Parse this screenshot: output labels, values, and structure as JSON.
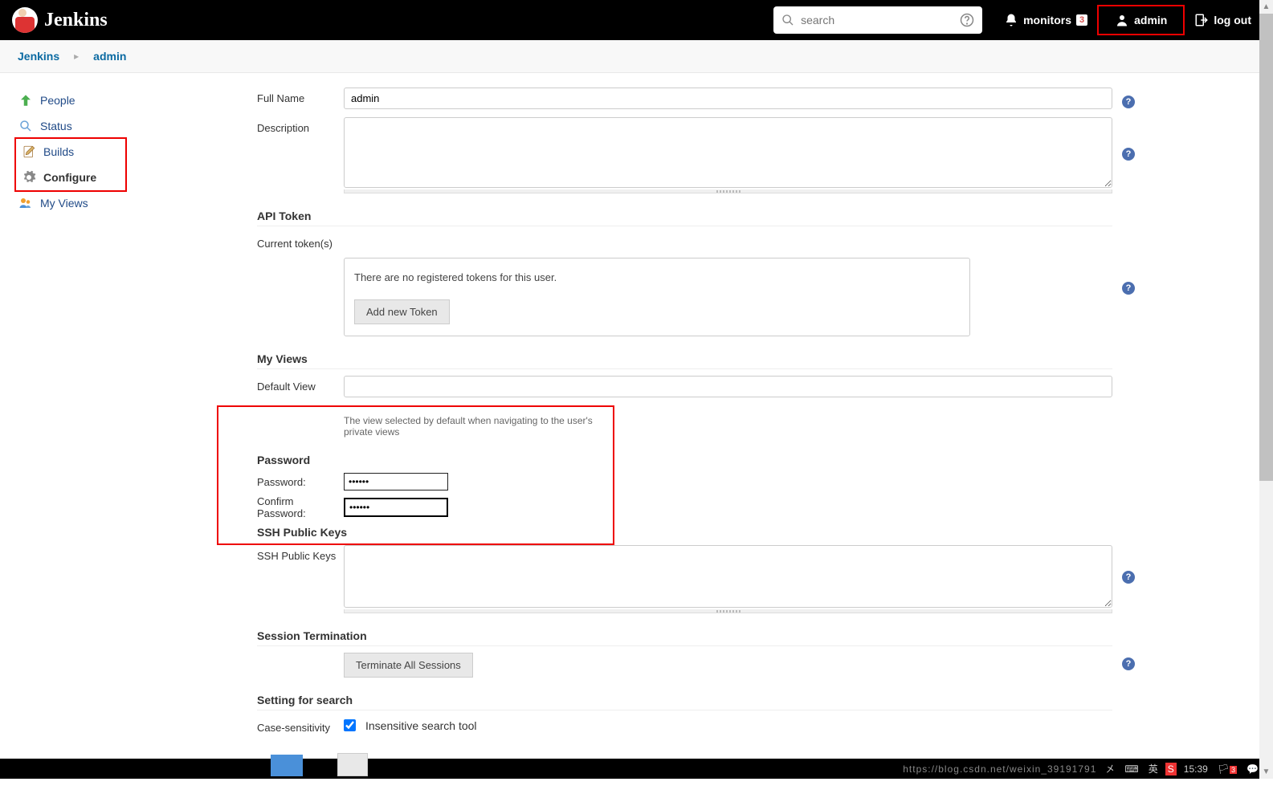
{
  "header": {
    "brand": "Jenkins",
    "search_placeholder": "search",
    "monitors_label": "monitors",
    "monitors_count": "3",
    "user_label": "admin",
    "logout_label": "log out"
  },
  "breadcrumb": {
    "root": "Jenkins",
    "current": "admin"
  },
  "sidebar": {
    "people": "People",
    "status": "Status",
    "builds": "Builds",
    "configure": "Configure",
    "myviews": "My Views"
  },
  "form": {
    "fullname_label": "Full Name",
    "fullname_value": "admin",
    "description_label": "Description",
    "description_value": ""
  },
  "api_token": {
    "title": "API Token",
    "current_label": "Current token(s)",
    "empty_msg": "There are no registered tokens for this user.",
    "add_btn": "Add new Token"
  },
  "myviews_section": {
    "title": "My Views",
    "default_label": "Default View",
    "default_value": "",
    "helptext": "The view selected by default when navigating to the user's private views"
  },
  "password": {
    "title": "Password",
    "pwd_label": "Password:",
    "pwd_value": "••••••",
    "confirm_label": "Confirm Password:",
    "confirm_value": "••••••"
  },
  "ssh": {
    "title": "SSH Public Keys",
    "label": "SSH Public Keys",
    "value": ""
  },
  "session": {
    "title": "Session Termination",
    "btn": "Terminate All Sessions"
  },
  "search_setting": {
    "title": "Setting for search",
    "label": "Case-sensitivity",
    "checkbox_label": "Insensitive search tool"
  },
  "footer": {
    "watermark": "https://blog.csdn.net/weixin_39191791",
    "time": "15:39"
  }
}
